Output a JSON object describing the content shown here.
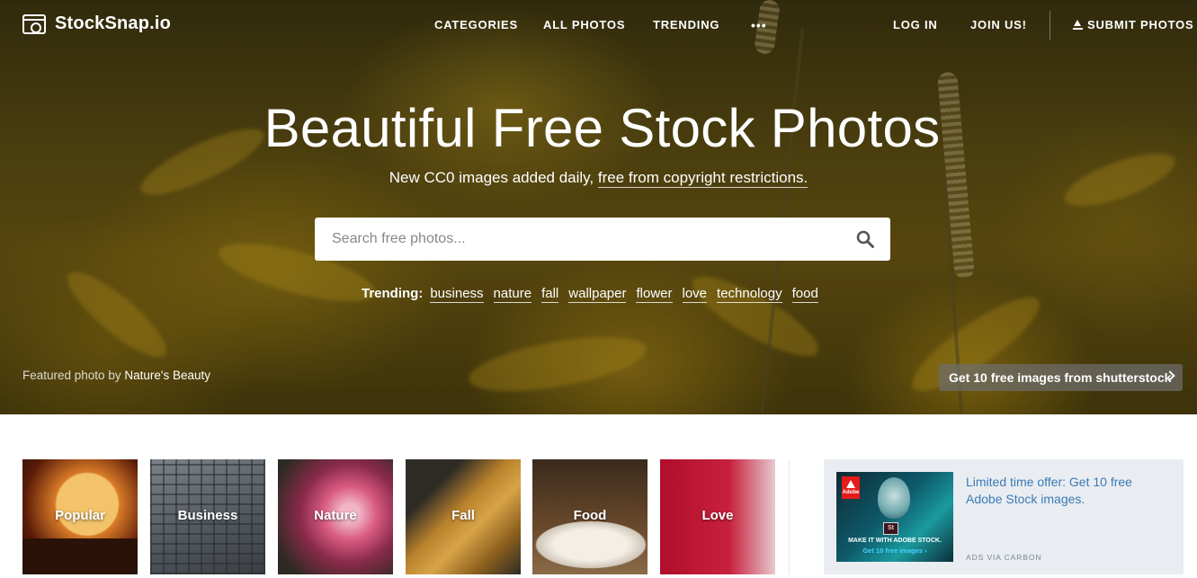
{
  "app": {
    "logo_text": "StockSnap.io"
  },
  "nav": {
    "categories": "CATEGORIES",
    "all_photos": "ALL PHOTOS",
    "trending": "TRENDING",
    "more": "•••",
    "log_in": "LOG IN",
    "join": "JOIN US!",
    "submit": "SUBMIT PHOTOS"
  },
  "hero": {
    "title": "Beautiful Free Stock Photos",
    "subtitle_prefix": "New CC0 images added daily,",
    "subtitle_link": "free from copyright restrictions.",
    "search_placeholder": "Search free photos...",
    "trending_label": "Trending:",
    "trending_tags": [
      "business",
      "nature",
      "fall",
      "wallpaper",
      "flower",
      "love",
      "technology",
      "food"
    ],
    "featured_prefix": "Featured photo by",
    "featured_author": "Nature's Beauty",
    "promo": "Get 10 free images from shutterstock"
  },
  "categories": [
    "Popular",
    "Business",
    "Nature",
    "Fall",
    "Food",
    "Love"
  ],
  "ad": {
    "brand_logo": "Adobe",
    "product_badge": "St",
    "tagline": "MAKE IT WITH ADOBE STOCK.",
    "cta": "Get 10 free images ›",
    "text": "Limited time offer: Get 10 free Adobe Stock images.",
    "via": "ADS VIA CARBON"
  },
  "colors": {
    "accent_link": "#3b7ab5",
    "ad_bg": "#e9edf1",
    "hero_base": "#5a4b12"
  },
  "icons": {
    "logo": "camera-icon",
    "submit": "upload-icon",
    "search": "search-icon",
    "promo": "chevron-right-icon"
  }
}
